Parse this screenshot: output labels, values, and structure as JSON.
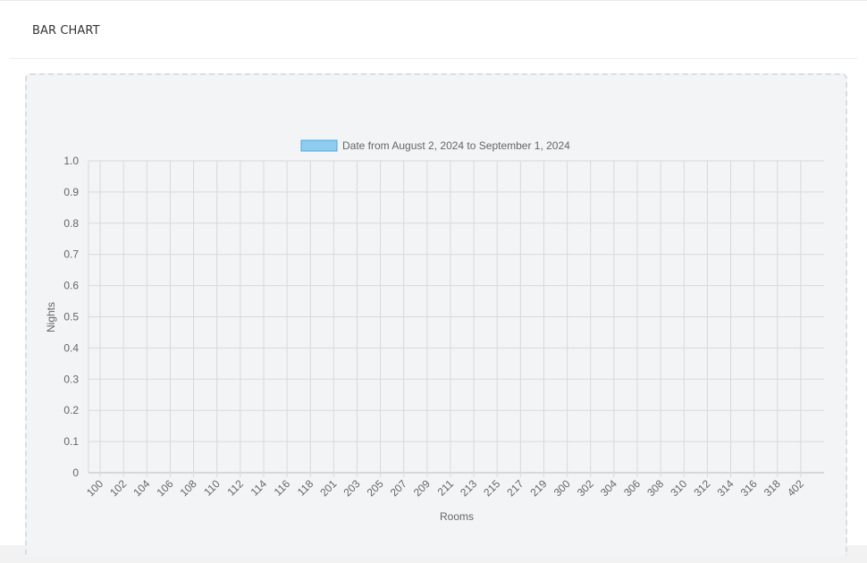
{
  "header": {
    "title": "BAR CHART"
  },
  "colors": {
    "bar_fill": "#8ecdf0",
    "bar_border": "#4da6dd",
    "grid": "#d9d9d9",
    "axis_text": "#666666"
  },
  "chart_data": {
    "type": "bar",
    "legend": [
      "Date from August 2, 2024 to September 1, 2024"
    ],
    "legend_position": "top",
    "xlabel": "Rooms",
    "ylabel": "Nights",
    "ylim": [
      0,
      1
    ],
    "yticks": [
      "0",
      "0.1",
      "0.2",
      "0.3",
      "0.4",
      "0.5",
      "0.6",
      "0.7",
      "0.8",
      "0.9",
      "1.0"
    ],
    "grid": true,
    "categories": [
      "100",
      "102",
      "104",
      "106",
      "108",
      "110",
      "112",
      "114",
      "116",
      "118",
      "201",
      "203",
      "205",
      "207",
      "209",
      "211",
      "213",
      "215",
      "217",
      "219",
      "300",
      "302",
      "304",
      "306",
      "308",
      "310",
      "312",
      "314",
      "316",
      "318",
      "402"
    ],
    "series": [
      {
        "name": "Date from August 2, 2024 to September 1, 2024",
        "values": [
          0,
          0,
          0,
          0,
          0,
          0,
          0,
          0,
          0,
          0,
          0,
          0,
          0,
          0,
          0,
          0,
          0,
          0,
          0,
          0,
          0,
          0,
          0,
          0,
          0,
          0,
          0,
          0,
          0,
          0,
          0
        ]
      }
    ]
  }
}
